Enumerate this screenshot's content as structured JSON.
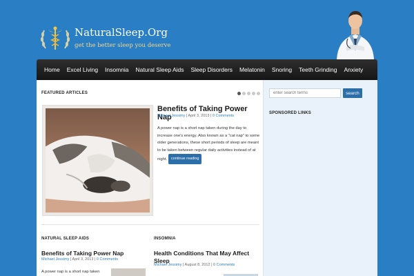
{
  "site": {
    "title": "NaturalSleep.Org",
    "tagline": "get the better sleep you deserve"
  },
  "nav": [
    "Home",
    "Excel Living",
    "Insomnia",
    "Natural Sleep Aids",
    "Sleep Disorders",
    "Melatonin",
    "Snoring",
    "Teeth Grinding",
    "Anxiety"
  ],
  "featured": {
    "label": "FEATURED ARTICLES",
    "slides": 5,
    "active_slide": 1,
    "title": "Benefits of Taking Power Nap",
    "author": "Michael Jessimy",
    "date": "April 3, 2013",
    "comments": "0 Comments",
    "excerpt": "A power nap is a short nap taken during the day to increase one's energy. Also known as a \"cat nap\" to some older generations, these short periods of sleep are meant to be taken between regular daily activities instead of at night.",
    "continue_label": "continue reading"
  },
  "columns": [
    {
      "label": "NATURAL SLEEP AIDS",
      "title": "Benefits of Taking Power Nap",
      "author": "Michael Jessimy",
      "date": "April 3, 2013",
      "comments": "0 Comments",
      "excerpt": "A power nap is a short nap taken"
    },
    {
      "label": "INSOMNIA",
      "title": "Health Conditions That May Affect Sleep",
      "author": "Michael Jessimy",
      "date": "August 8, 2012",
      "comments": "0 Comments",
      "excerpt": ""
    }
  ],
  "sidebar": {
    "search_placeholder": "enter search terms",
    "search_button": "search",
    "sponsored_label": "SPONSORED LINKS"
  },
  "colors": {
    "background": "#2a7fc4",
    "nav": "#1e1e1e",
    "accent": "#2c6ea8",
    "tagline": "#f3d78c"
  }
}
